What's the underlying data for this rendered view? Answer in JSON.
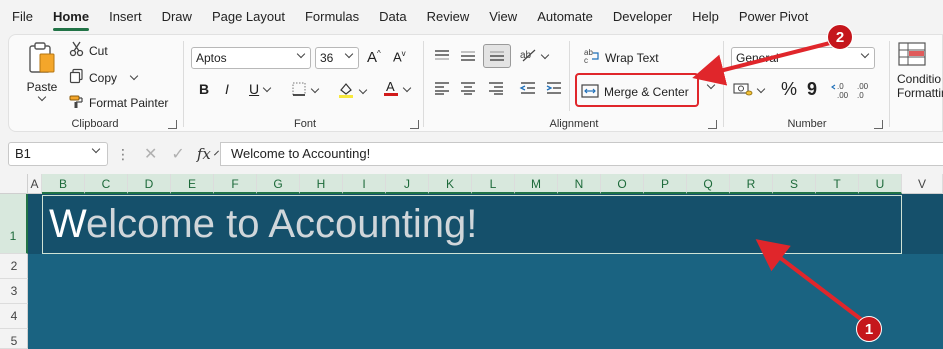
{
  "menu": {
    "tabs": [
      "File",
      "Home",
      "Insert",
      "Draw",
      "Page Layout",
      "Formulas",
      "Data",
      "Review",
      "View",
      "Automate",
      "Developer",
      "Help",
      "Power Pivot"
    ],
    "active": "Home"
  },
  "clipboard": {
    "paste_label": "Paste",
    "cut_label": "Cut",
    "copy_label": "Copy",
    "format_painter_label": "Format Painter",
    "group_label": "Clipboard"
  },
  "font": {
    "family": "Aptos",
    "size": "36",
    "bold": "B",
    "italic": "I",
    "underline": "U",
    "group_label": "Font",
    "fill_color": "#f7e83c",
    "font_color": "#d11b1b"
  },
  "alignment": {
    "wrap_text_label": "Wrap Text",
    "merge_center_label": "Merge & Center",
    "group_label": "Alignment"
  },
  "number": {
    "format": "General",
    "percent": "%",
    "comma": "9",
    "group_label": "Number"
  },
  "styles": {
    "conditional_formatting_label_1": "Conditio",
    "conditional_formatting_label_2": "Formattin"
  },
  "formula_bar": {
    "cell_ref": "B1",
    "fx": "fx",
    "content": "Welcome to Accounting!"
  },
  "grid": {
    "columns": [
      "A",
      "B",
      "C",
      "D",
      "E",
      "F",
      "G",
      "H",
      "I",
      "J",
      "K",
      "L",
      "M",
      "N",
      "O",
      "P",
      "Q",
      "R",
      "S",
      "T",
      "U",
      "V"
    ],
    "rows": [
      "1",
      "2",
      "3",
      "4",
      "5"
    ],
    "merged_first_letter": "W",
    "merged_rest": "elcome to Accounting!",
    "sheet_color": "#1a6381"
  },
  "annotations": {
    "step1": "1",
    "step2": "2",
    "color": "#e0262b"
  }
}
